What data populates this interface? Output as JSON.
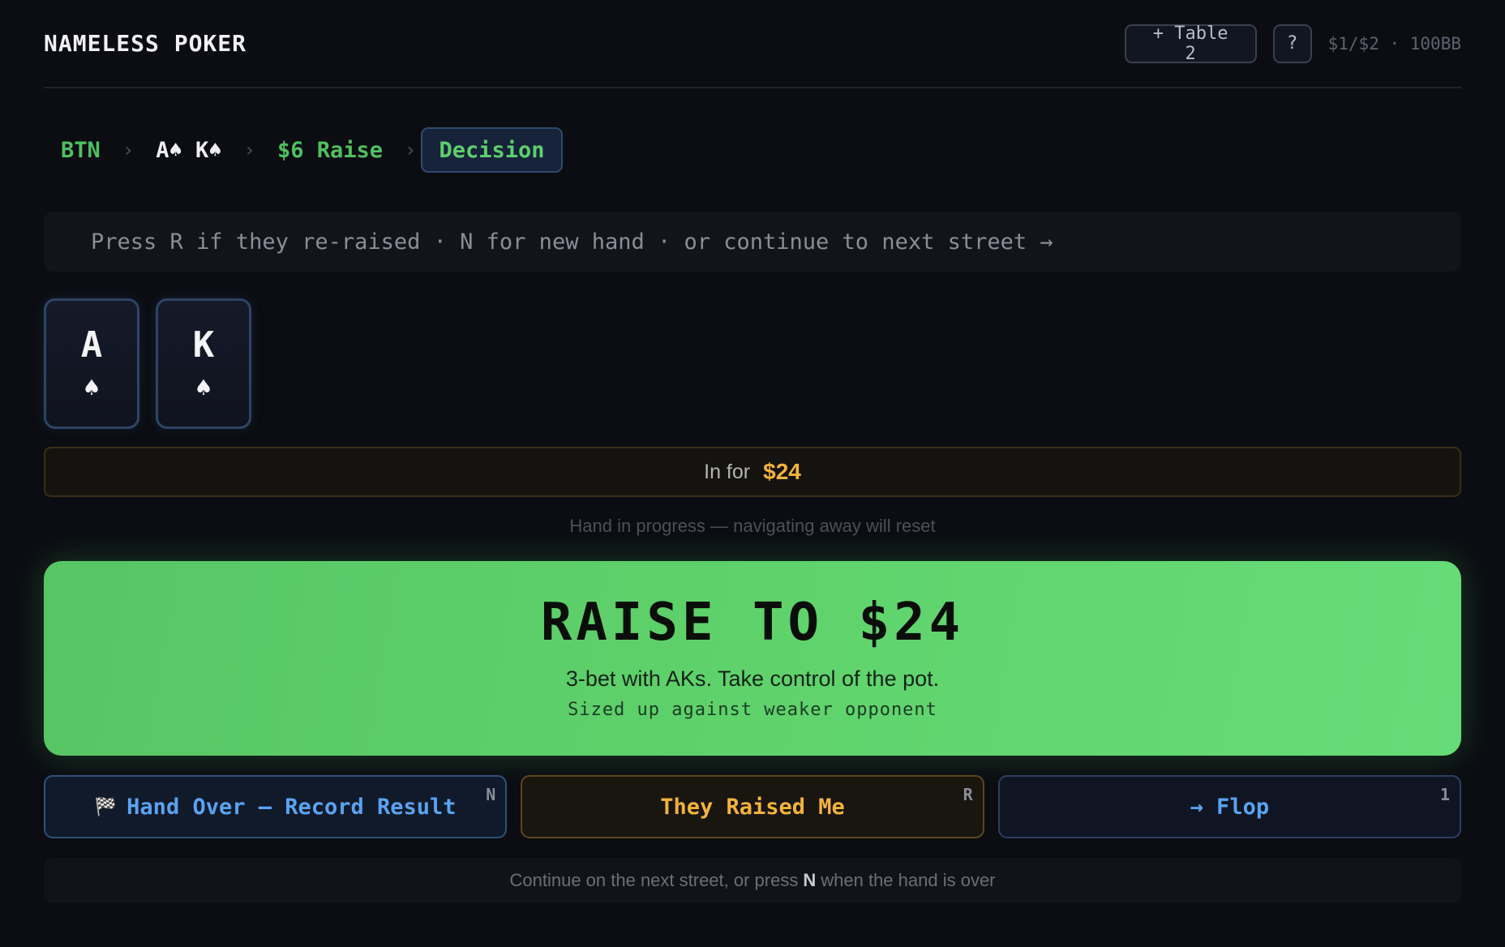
{
  "header": {
    "brand": "NAMELESS POKER",
    "add_table_label": "+ Table 2",
    "help_label": "?",
    "stakes": "$1/$2 · 100BB"
  },
  "breadcrumb": {
    "position": "BTN",
    "hand": "A♠ K♠",
    "action": "$6 Raise",
    "current": "Decision",
    "separator": "›"
  },
  "hint": "Press R if they re-raised · N for new hand · or continue to next street →",
  "cards": [
    {
      "rank": "A",
      "suit": "♠"
    },
    {
      "rank": "K",
      "suit": "♠"
    }
  ],
  "invested": {
    "label": "In for",
    "amount": "$24"
  },
  "progress_note": "Hand in progress — navigating away will reset",
  "recommendation": {
    "headline": "RAISE TO $24",
    "reason": "3-bet with AKs. Take control of the pot.",
    "sizing": "Sized up against weaker opponent",
    "color": "#5fd26b"
  },
  "buttons": {
    "hand_over": {
      "icon": "checkered-flag-icon",
      "label": "Hand Over — Record Result",
      "key": "N"
    },
    "raised": {
      "label": "They Raised Me",
      "key": "R"
    },
    "flop": {
      "label": "→ Flop",
      "key": "1"
    }
  },
  "footer": {
    "before": "Continue on the next street, or press",
    "key": "N",
    "after": "when the hand is over"
  }
}
